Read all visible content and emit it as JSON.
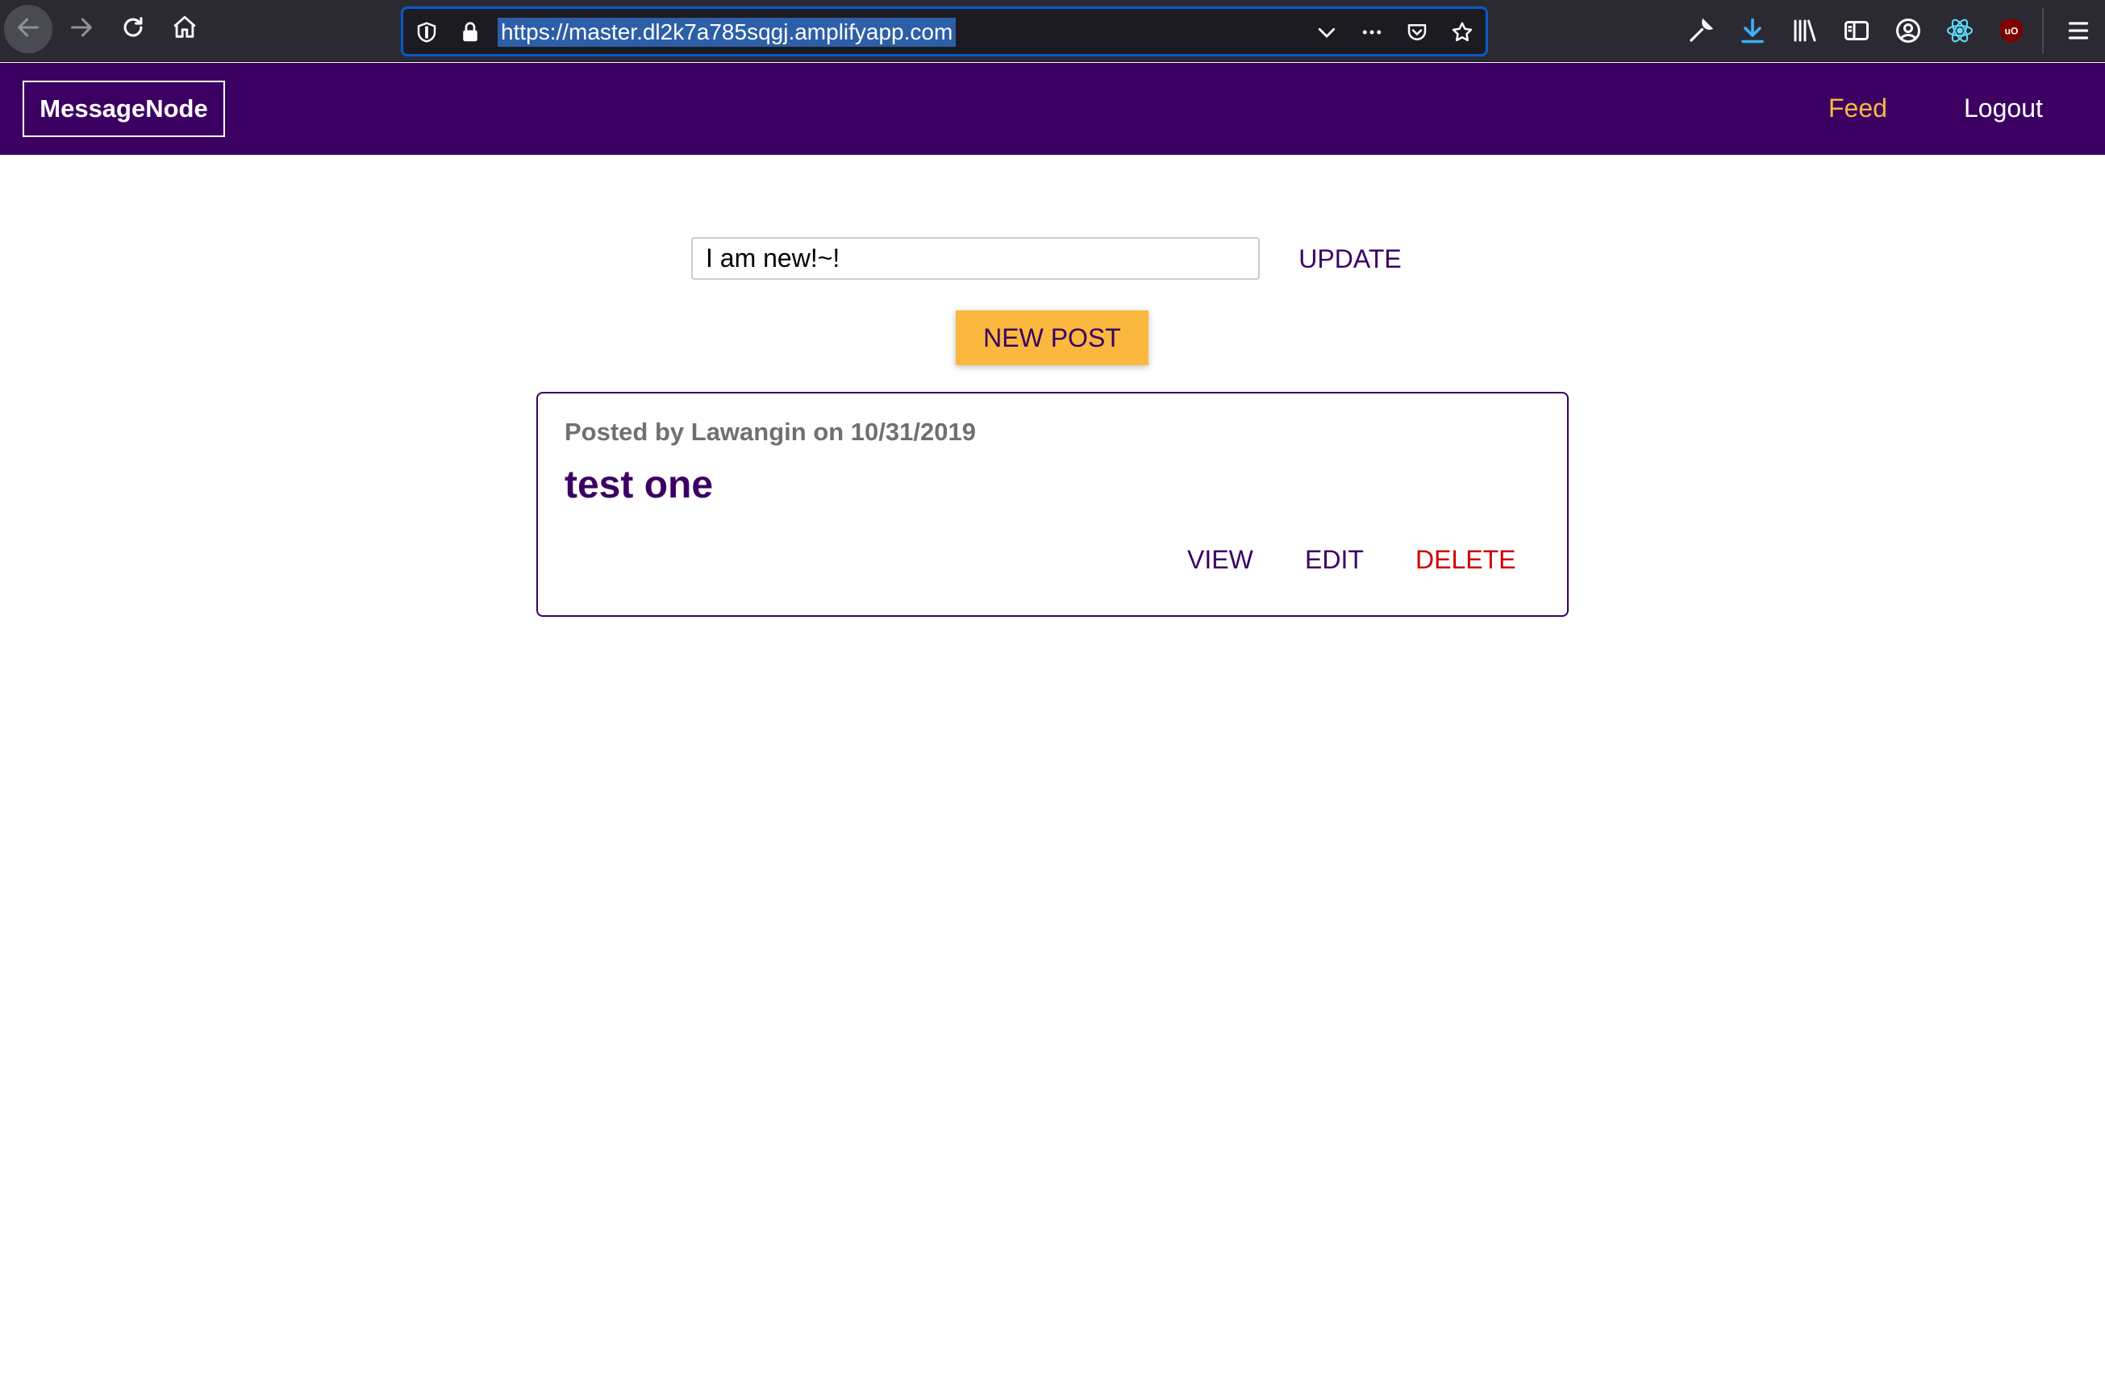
{
  "browser": {
    "url": "https://master.dl2k7a785sqgj.amplifyapp.com",
    "icons": {
      "back": "arrow-left-icon",
      "forward": "arrow-right-icon",
      "reload": "reload-icon",
      "home": "home-icon",
      "tracking": "shield-icon",
      "lock": "lock-icon",
      "dropdown": "chevron-down-icon",
      "more": "ellipsis-icon",
      "pocket": "pocket-icon",
      "bookmark": "star-icon",
      "tools": "wrench-icon",
      "downloads": "download-icon",
      "library": "library-icon",
      "sidebar": "sidebar-icon",
      "account": "account-icon",
      "react_devtools": "react-icon",
      "ublock": "ublock-icon",
      "menu": "hamburger-menu-icon"
    }
  },
  "app": {
    "logo": "MessageNode",
    "nav": {
      "feed": "Feed",
      "logout": "Logout"
    },
    "colors": {
      "brand": "#3b0062",
      "accent": "#fab83f",
      "danger": "#cf0000"
    }
  },
  "status": {
    "value": "I am new!~!",
    "update_label": "UPDATE"
  },
  "new_post_label": "NEW POST",
  "posts": [
    {
      "meta": "Posted by Lawangin on 10/31/2019",
      "title": "test one",
      "actions": {
        "view": "VIEW",
        "edit": "EDIT",
        "delete": "DELETE"
      }
    }
  ]
}
